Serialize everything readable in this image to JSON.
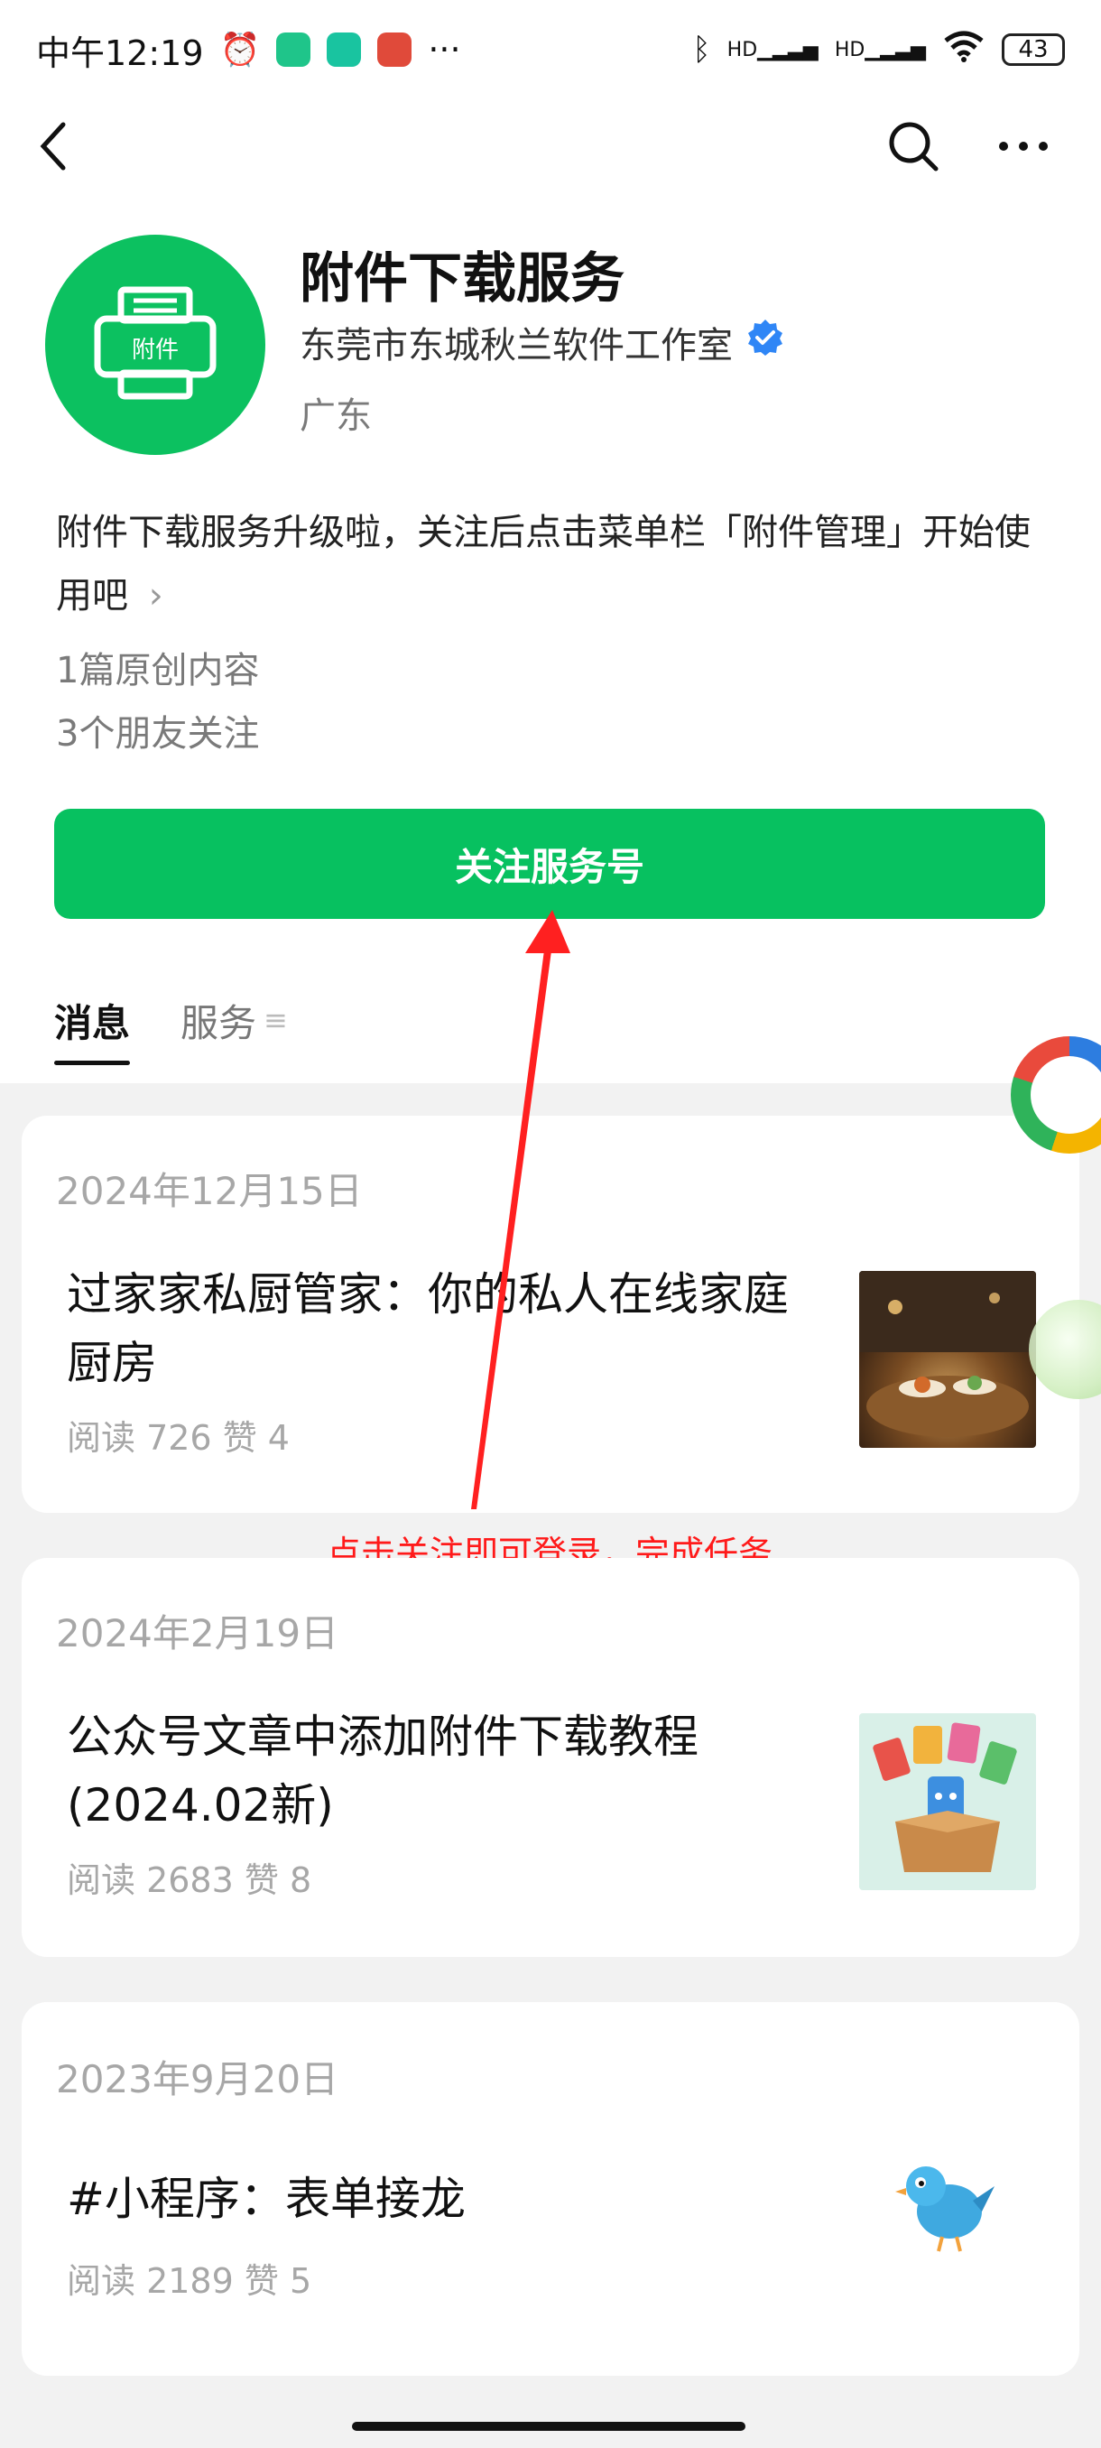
{
  "status_bar": {
    "time": "中午12:19",
    "more": "···",
    "battery": "43",
    "signal1_label": "HD",
    "signal2_label": "HD"
  },
  "account": {
    "name": "附件下载服务",
    "owner": "东莞市东城秋兰软件工作室",
    "region": "广东",
    "avatar_label": "附件",
    "intro": "附件下载服务升级啦，关注后点击菜单栏「附件管理」开始使用吧",
    "intro_more": "›",
    "original_count": "1篇原创内容",
    "friends_following": "3个朋友关注",
    "follow_button": "关注服务号"
  },
  "tabs": [
    {
      "label": "消息",
      "active": true
    },
    {
      "label": "服务",
      "active": false
    }
  ],
  "tab_menu_glyph": "≡",
  "articles": [
    {
      "date": "2024年12月15日",
      "title": "过家家私厨管家：你的私人在线家庭厨房",
      "stats": "阅读 726   赞 4",
      "thumb": "dining-table-food"
    },
    {
      "date": "2024年2月19日",
      "title": "公众号文章中添加附件下载教程(2024.02新)",
      "stats": "阅读 2683   赞 8",
      "thumb": "box-with-files"
    },
    {
      "date": "2023年9月20日",
      "title": "#小程序：表单接龙",
      "stats": "阅读 2189   赞 5",
      "thumb": "blue-bird"
    }
  ],
  "annotation": "点击关注即可登录，完成任务",
  "colors": {
    "brand_green": "#07c160",
    "annotation_red": "#ff1a1a",
    "verified_blue": "#2f86f6",
    "feed_bg": "#f2f2f2"
  }
}
